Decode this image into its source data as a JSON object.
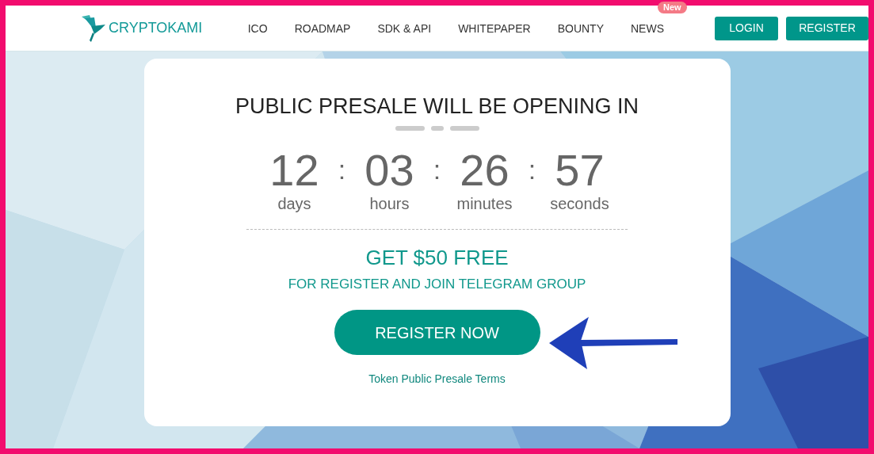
{
  "header": {
    "logo": "CRYPTOKAMI",
    "nav": [
      {
        "label": "ICO"
      },
      {
        "label": "ROADMAP"
      },
      {
        "label": "SDK & API"
      },
      {
        "label": "WHITEPAPER"
      },
      {
        "label": "BOUNTY"
      },
      {
        "label": "NEWS",
        "badge": "New"
      }
    ],
    "buttons": [
      "LOGIN",
      "REGISTER"
    ]
  },
  "card": {
    "title": "PUBLIC PRESALE WILL BE OPENING IN",
    "countdown": [
      {
        "value": "12",
        "unit": "days"
      },
      {
        "value": "03",
        "unit": "hours"
      },
      {
        "value": "26",
        "unit": "minutes"
      },
      {
        "value": "57",
        "unit": "seconds"
      }
    ],
    "separator": ":",
    "offer": "GET $50 FREE",
    "offer_subtitle": "FOR REGISTER AND JOIN TELEGRAM GROUP",
    "cta": "REGISTER NOW",
    "terms_link": "Token Public Presale Terms"
  }
}
